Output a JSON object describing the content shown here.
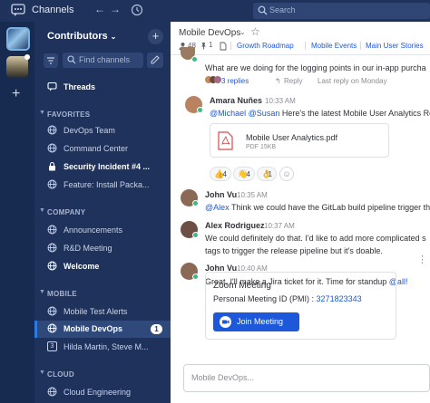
{
  "topbar": {
    "app_title": "Channels",
    "search_placeholder": "Search"
  },
  "rail": {
    "add": "+"
  },
  "sidebar": {
    "team_name": "Contributors",
    "find_placeholder": "Find channels",
    "threads": "Threads",
    "categories": [
      {
        "label": "FAVORITES",
        "items": [
          "DevOps Team",
          "Command Center",
          "Security Incident #4 ...",
          "Feature: Install Packa..."
        ]
      },
      {
        "label": "COMPANY",
        "items": [
          "Announcements",
          "R&D Meeting",
          "Welcome"
        ]
      },
      {
        "label": "MOBILE",
        "items": [
          "Mobile Test Alerts",
          "Mobile DevOps",
          "Hilda Martin, Steve M..."
        ]
      },
      {
        "label": "CLOUD",
        "items": [
          "Cloud Engineering"
        ]
      }
    ],
    "active_badge": "1"
  },
  "channel": {
    "name": "Mobile DevOps",
    "member_count": "48",
    "pinned_count": "1",
    "links": [
      "Growth Roadmap",
      "Mobile Events",
      "Main User Stories"
    ]
  },
  "messages": {
    "m0": {
      "text": "What are we doing for the logging points in our in-app purcha",
      "replies": "3 replies",
      "reply": "Reply",
      "last_reply": "Last reply on Monday"
    },
    "m1": {
      "author": "Amara Nuñes",
      "time": "10:33 AM",
      "mention1": "@Michael",
      "mention2": "@Susan",
      "text": "Here's the latest Mobile User Analytics Re",
      "file_name": "Mobile User Analytics.pdf",
      "file_type": "PDF",
      "file_size": "15KB"
    },
    "reactions": [
      {
        "emoji": "👍",
        "count": "4"
      },
      {
        "emoji": "👋",
        "count": "4"
      },
      {
        "emoji": "👌",
        "count": "1"
      }
    ],
    "m2": {
      "author": "John Vu",
      "time": "10:35 AM",
      "mention": "@Alex",
      "text": "Think we could have the GitLab build pipeline trigger th"
    },
    "m3": {
      "author": "Alex Rodriguez",
      "time": "10:37 AM",
      "line1": "We could definitely do that. I'd like to add more complicated s",
      "line2": "tags to trigger the release pipeline but it's doable."
    },
    "m4": {
      "author": "John Vu",
      "time": "10:40 AM",
      "text": "Great, I'll make a Jira ticket for it. Time for standup ",
      "mention": "@all!"
    },
    "zoom": {
      "title": "Zoom Meeting",
      "id_label": "Personal Meeting ID (PMI) : ",
      "id_value": "3271823343",
      "button": "Join Meeting"
    }
  },
  "compose": {
    "placeholder": "Mobile DevOps..."
  }
}
